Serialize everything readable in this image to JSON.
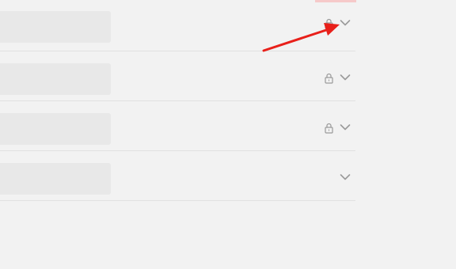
{
  "colors": {
    "background": "#f2f2f2",
    "placeholder_bar": "#e8e8e8",
    "divider": "#e1e1e1",
    "icon": "#9a9a9a",
    "annotation_arrow": "#e8201a",
    "top_accent": "#f6c9c9"
  },
  "list": {
    "rows": [
      {
        "locked": true,
        "expand_icon": "chevron-down-icon",
        "lock_icon": "lock-icon"
      },
      {
        "locked": true,
        "expand_icon": "chevron-down-icon",
        "lock_icon": "lock-icon"
      },
      {
        "locked": true,
        "expand_icon": "chevron-down-icon",
        "lock_icon": "lock-icon"
      },
      {
        "locked": false,
        "expand_icon": "chevron-down-icon"
      }
    ]
  },
  "annotation": {
    "type": "arrow",
    "target": "first-row-chevron"
  }
}
